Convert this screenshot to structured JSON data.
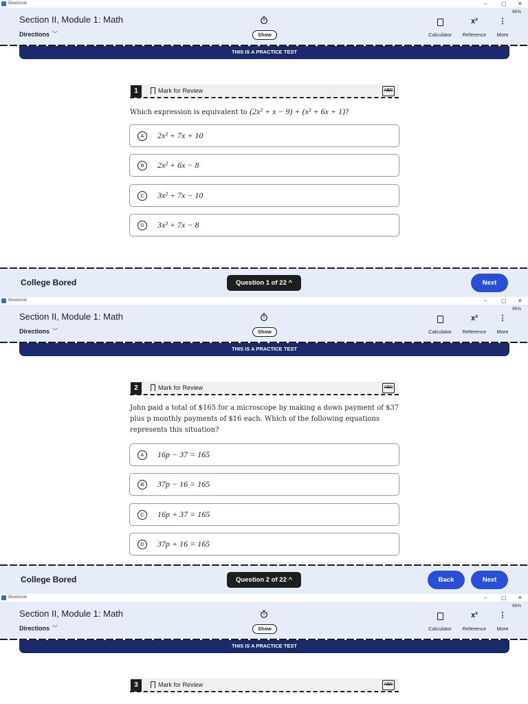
{
  "window": {
    "app_name": "Bluebook",
    "min": "–",
    "max": "▢",
    "close": "✕"
  },
  "header": {
    "section_title": "Section II, Module 1: Math",
    "directions_label": "Directions",
    "show_label": "Show",
    "battery": "95%",
    "calculator_label": "Calculator",
    "reference_label": "Reference",
    "reference_icon": "x²",
    "more_label": "More",
    "more_icon": "⋮"
  },
  "banner": "THIS IS A PRACTICE TEST",
  "mark_for_review": "Mark for Review",
  "abc_label": "ABC",
  "footer": {
    "brand": "College Bored",
    "next_label": "Next",
    "back_label": "Back"
  },
  "frames": [
    {
      "question_number": "1",
      "question_text": "Which expression is equivalent to",
      "question_math": "(2x² + x − 9) + (x² + 6x + 1)",
      "question_end": "?",
      "choices": [
        {
          "letter": "A",
          "text": "2x² + 7x + 10"
        },
        {
          "letter": "B",
          "text": "2x² + 6x − 8"
        },
        {
          "letter": "C",
          "text": "3x² + 7x − 10"
        },
        {
          "letter": "D",
          "text": "3x² + 7x − 8"
        }
      ],
      "nav": "Question 1 of 22 ^"
    },
    {
      "question_number": "2",
      "question_line1": "John paid a total of $165 for a microscope by making a down payment of $37",
      "question_line2": "plus p monthly payments of $16 each. Which of the following equations",
      "question_line3": "represents this situation?",
      "choices": [
        {
          "letter": "A",
          "text": "16p − 37 = 165"
        },
        {
          "letter": "B",
          "text": "37p − 16 = 165"
        },
        {
          "letter": "C",
          "text": "16p + 37 = 165"
        },
        {
          "letter": "D",
          "text": "37p + 16 = 165"
        }
      ],
      "nav": "Question 2 of 22 ^"
    },
    {
      "question_number": "3"
    }
  ]
}
